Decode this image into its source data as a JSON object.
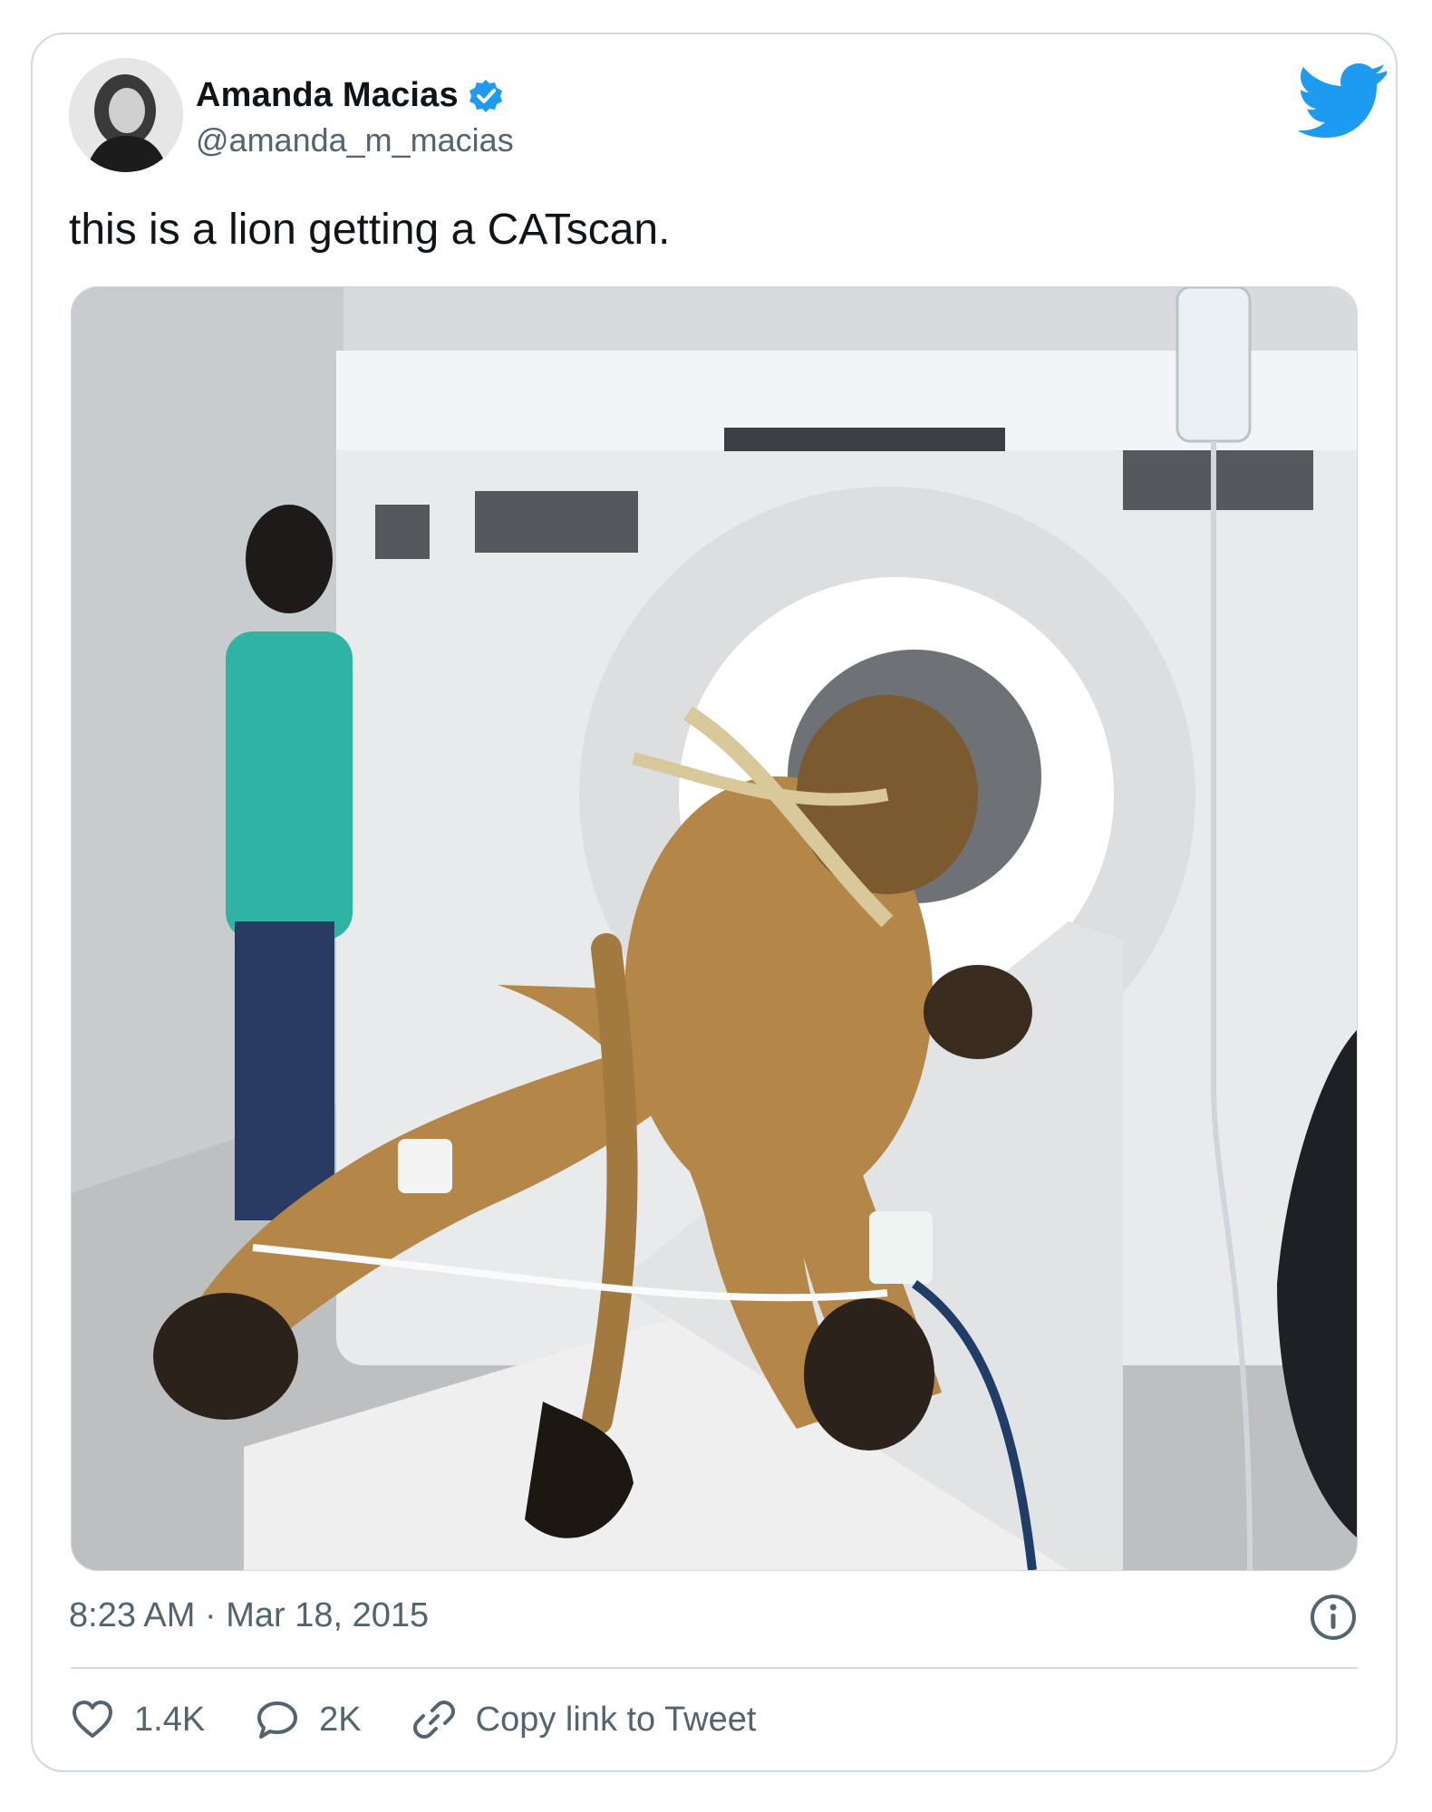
{
  "tweet": {
    "author_name": "Amanda Macias",
    "author_handle": "@amanda_m_macias",
    "text": "this is a lion getting a CATscan.",
    "timestamp": "8:23 AM · Mar 18, 2015"
  },
  "actions": {
    "like_count": "1.4K",
    "reply_count": "2K",
    "copy_link_label": "Copy link to Tweet"
  },
  "icons": {
    "verified": "verified-badge-icon",
    "brand": "twitter-bird-icon",
    "info": "info-icon",
    "like": "heart-icon",
    "reply": "speech-bubble-icon",
    "link": "chain-link-icon"
  },
  "colors": {
    "brand_blue": "#1d9bf0",
    "text_primary": "#0f1419",
    "text_secondary": "#536471",
    "border": "#cfd9de"
  }
}
